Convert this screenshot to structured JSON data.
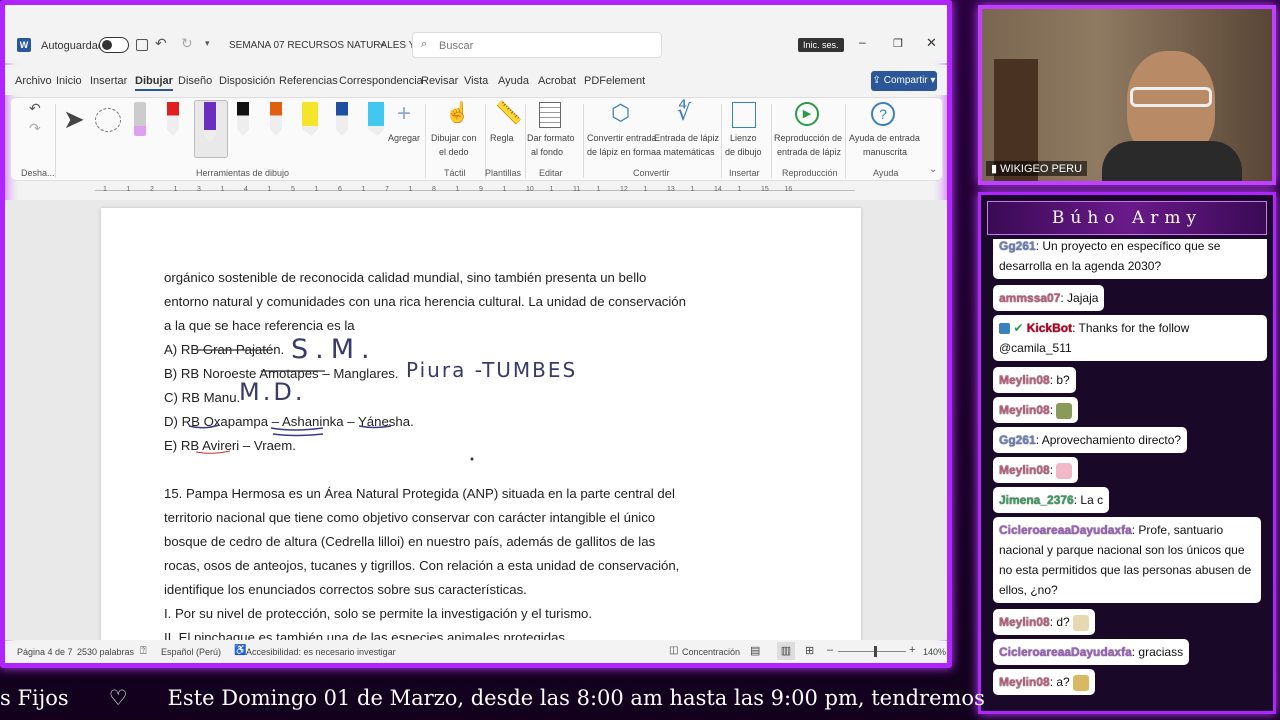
{
  "word": {
    "autosave": "Autoguardado",
    "doc_title": "SEMANA 07 RECURSOS NATURALES Y...",
    "search_placeholder": "Buscar",
    "signin": "Inic. ses.",
    "share": "Compartir",
    "tabs": [
      "Archivo",
      "Inicio",
      "Insertar",
      "Dibujar",
      "Diseño",
      "Disposición",
      "Referencias",
      "Correspondencia",
      "Revisar",
      "Vista",
      "Ayuda",
      "Acrobat",
      "PDFelement"
    ],
    "ribbon": {
      "undo_label": "Desha...",
      "tools_label": "Herramientas de dibujo",
      "add": "Agregar",
      "draw_finger": [
        "Dibujar con",
        "el dedo"
      ],
      "ruler": "Regla",
      "bg_format": [
        "Dar formato",
        "al fondo"
      ],
      "convert_shape": [
        "Convertir entrada",
        "de lápiz en forma"
      ],
      "math": [
        "Entrada de lápiz",
        "a matemáticas"
      ],
      "canvas": [
        "Lienzo",
        "de dibujo"
      ],
      "replay": [
        "Reproducción de",
        "entrada de lápiz"
      ],
      "help_ink": [
        "Ayuda de entrada",
        "manuscrita"
      ],
      "groups": [
        "Táctil",
        "Plantillas",
        "Editar",
        "Convertir",
        "Insertar",
        "Reproducción",
        "Ayuda"
      ]
    },
    "ruler_nums": [
      "1",
      "1",
      "2",
      "1",
      "3",
      "1",
      "4",
      "1",
      "5",
      "1",
      "6",
      "1",
      "7",
      "1",
      "8",
      "1",
      "9",
      "1",
      "10",
      "1",
      "11",
      "1",
      "12",
      "1",
      "13",
      "1",
      "14",
      "1",
      "15",
      "16"
    ],
    "doc_lines": [
      "orgánico sostenible de reconocida calidad mundial, sino también presenta un bello",
      "entorno natural y comunidades con una rica herencia cultural. La unidad de conservación",
      "a la que se hace referencia es la",
      "A) RB Gran Pajatén.",
      "B) RB Noroeste Amotapes – Manglares.",
      "C) RB Manu.",
      "D) RB Oxapampa – Ashaninka – Yánesha.",
      "E) RB Avireri – Vraem.",
      "15. Pampa Hermosa es un Área Natural Protegida (ANP) situada en la parte central del",
      "territorio nacional que tiene como objetivo conservar con carácter intangible el único",
      "bosque de cedro de altura (Cedrella lilloi) en nuestro país, además de gallitos de las",
      "rocas, osos de anteojos, tucanes y tigrillos. Con relación a esta unidad de conservación,",
      "identifique los enunciados correctos sobre sus características.",
      "I. Por su nivel de protección, solo se permite la investigación y el turismo.",
      "II. El pinchaque es también una de las especies animales protegidas."
    ],
    "ink": {
      "sm": "S.M.",
      "piura": "Piura -TUMBES",
      "md": "M.D."
    },
    "status": {
      "page": "Página 4 de 7",
      "words": "2530 palabras",
      "lang": "Español (Perú)",
      "access": "Accesibilidad: es necesario investigar",
      "focus": "Concentración",
      "zoom": "140%"
    }
  },
  "cam": {
    "name": "WIKIGEO PERU"
  },
  "chat": {
    "title": "Búho Army",
    "messages": [
      {
        "user": "Gg261",
        "text": ": Un proyecto en específico que se desarrolla en la agenda 2030?"
      },
      {
        "user": "ammssa07",
        "text": ": Jajaja"
      },
      {
        "user": "KickBot",
        "text": ": Thanks for the follow @camila_511"
      },
      {
        "user": "Meylin08",
        "text": ": b?"
      },
      {
        "user": "Meylin08",
        "text": ":"
      },
      {
        "user": "Gg261",
        "text": ": Aprovechamiento directo?"
      },
      {
        "user": "Meylin08",
        "text": ":"
      },
      {
        "user": "Jimena_2376",
        "text": ": La c"
      },
      {
        "user": "CicleroareaaDayudaxfa",
        "text": ": Profe, santuario nacional y parque nacional son los únicos que no esta permitidos que las personas abusen de ellos, ¿no?"
      },
      {
        "user": "Meylin08",
        "text": ": d?"
      },
      {
        "user": "CicleroareaaDayudaxfa",
        "text": ": graciass"
      },
      {
        "user": "Meylin08",
        "text": ": a?"
      }
    ]
  },
  "ticker": {
    "text": "s Fijos      ♡      Este Domingo 01 de Marzo, desde las 8:00 am hasta las 9:00 pm, tendremos"
  }
}
